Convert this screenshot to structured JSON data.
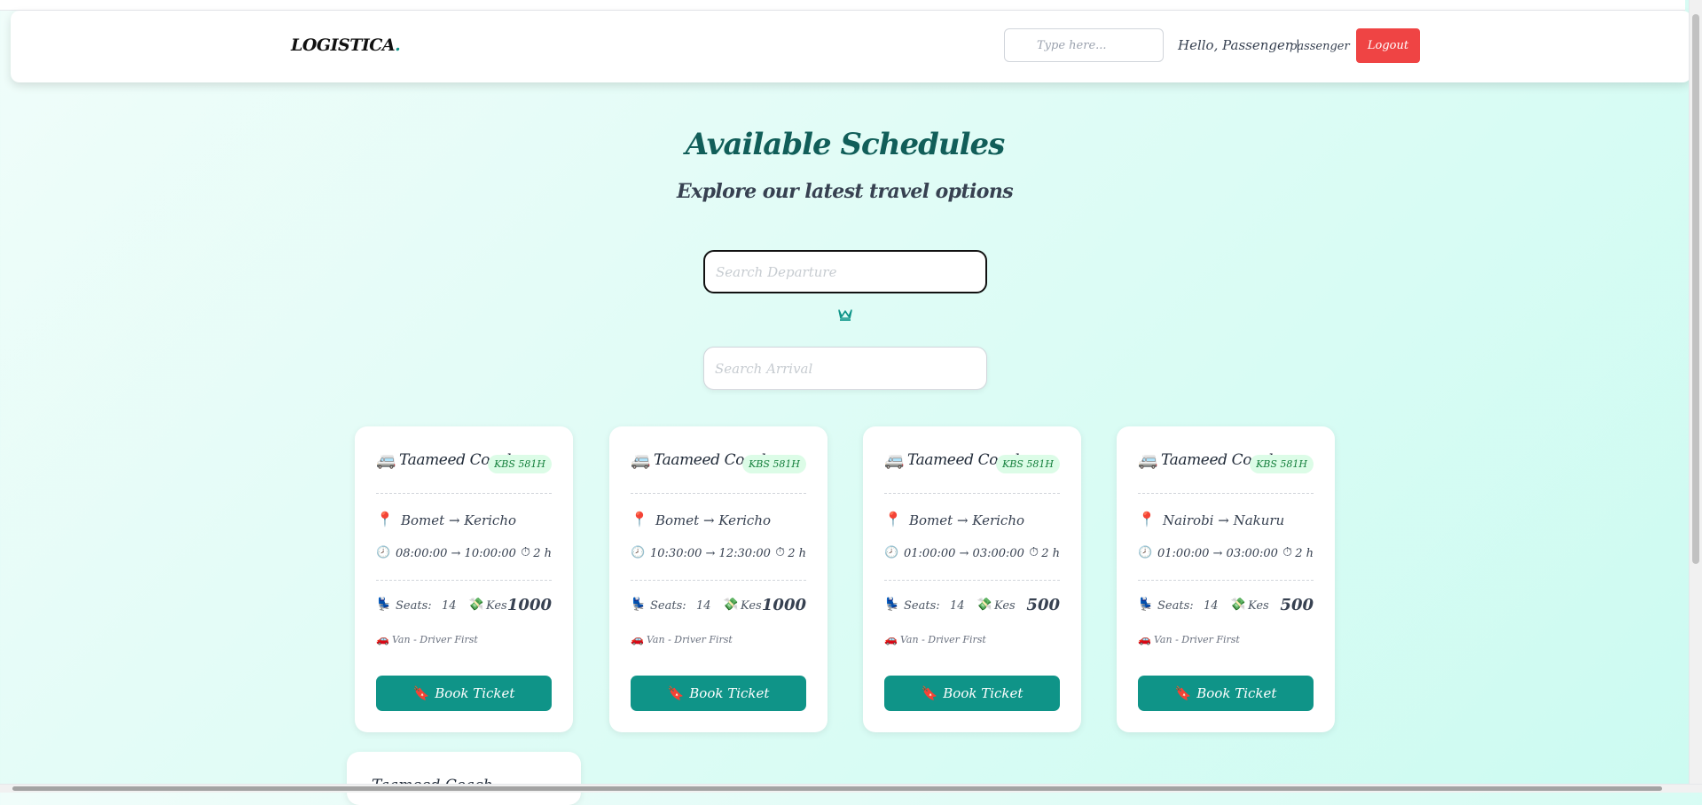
{
  "header": {
    "brand": "LOGISTICA",
    "brand_dot": ".",
    "search_placeholder": "Type here...",
    "greeting": "Hello, Passenger |",
    "role": "passenger",
    "logout_label": "Logout"
  },
  "main": {
    "title": "Available Schedules",
    "subtitle": "Explore our latest travel options",
    "departure_placeholder": "Search Departure",
    "arrival_placeholder": "Search Arrival",
    "swap_icon": "crown-swap-icon"
  },
  "schedules": [
    {
      "coach": "Taameed Coach",
      "plate": "KBS 581H",
      "route": "Bomet → Kericho",
      "times": "08:00:00 → 10:00:00",
      "duration": "2 h",
      "seats_label": "Seats:",
      "seats": "14",
      "currency": "Kes",
      "price": "1000",
      "vehicle": "Van - Driver First",
      "book_label": "Book Ticket"
    },
    {
      "coach": "Taameed Coach",
      "plate": "KBS 581H",
      "route": "Bomet → Kericho",
      "times": "10:30:00 → 12:30:00",
      "duration": "2 h",
      "seats_label": "Seats:",
      "seats": "14",
      "currency": "Kes",
      "price": "1000",
      "vehicle": "Van - Driver First",
      "book_label": "Book Ticket"
    },
    {
      "coach": "Taameed Coach",
      "plate": "KBS 581H",
      "route": "Bomet → Kericho",
      "times": "01:00:00 → 03:00:00",
      "duration": "2 h",
      "seats_label": "Seats:",
      "seats": "14",
      "currency": "Kes",
      "price": "500",
      "vehicle": "Van - Driver First",
      "book_label": "Book Ticket"
    },
    {
      "coach": "Taameed Coach",
      "plate": "KBS 581H",
      "route": "Nairobi → Nakuru",
      "times": "01:00:00 → 03:00:00",
      "duration": "2 h",
      "seats_label": "Seats:",
      "seats": "14",
      "currency": "Kes",
      "price": "500",
      "vehicle": "Van - Driver First",
      "book_label": "Book Ticket"
    }
  ],
  "partial_card": {
    "coach": "Taameed Coach"
  },
  "colors": {
    "accent": "#0f9488",
    "logout": "#ef4444",
    "plate_bg": "#dcfce7"
  }
}
